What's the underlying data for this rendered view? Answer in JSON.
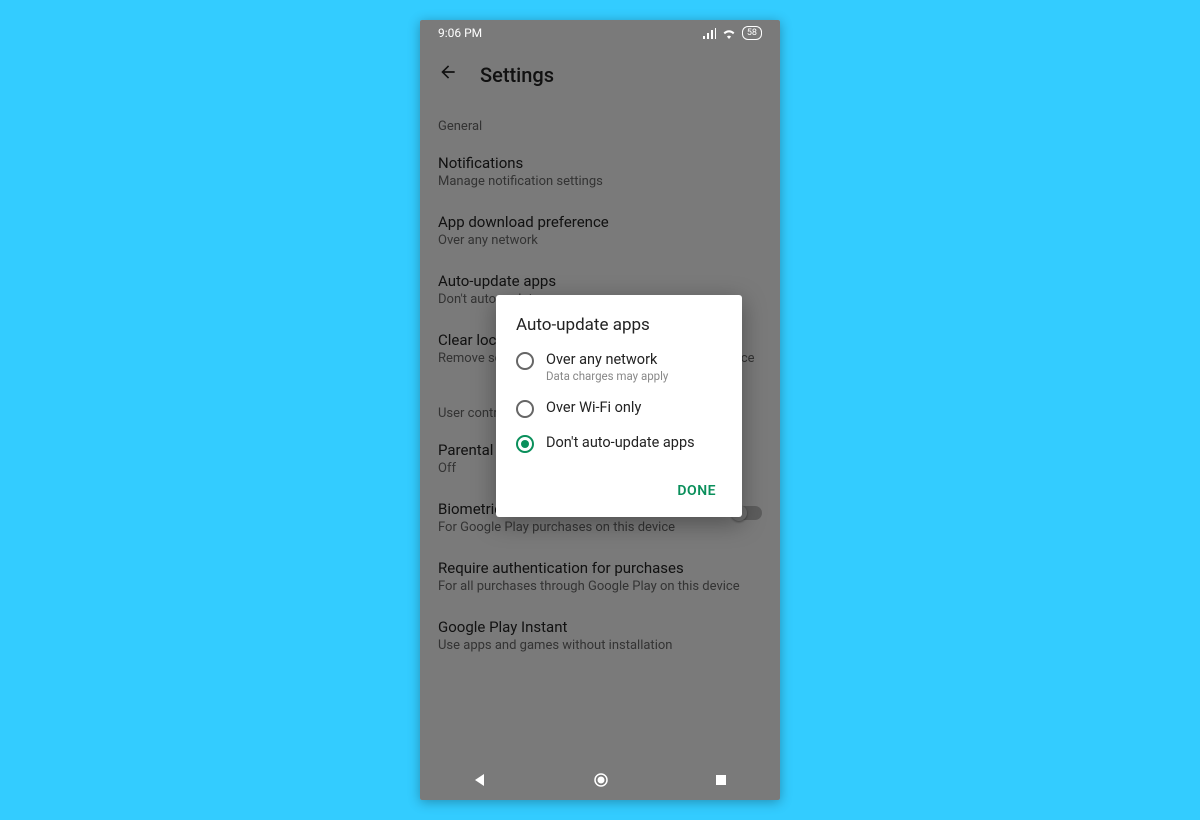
{
  "statusbar": {
    "time": "9:06 PM",
    "battery": "58"
  },
  "header": {
    "title": "Settings"
  },
  "sections": {
    "general_label": "General",
    "user_label": "User controls"
  },
  "rows": {
    "notifications": {
      "title": "Notifications",
      "sub": "Manage notification settings"
    },
    "download_pref": {
      "title": "App download preference",
      "sub": "Over any network"
    },
    "auto_update": {
      "title": "Auto-update apps",
      "sub": "Don't auto-update apps"
    },
    "clear": {
      "title": "Clear local search history",
      "sub": "Remove searches you have performed from this device"
    },
    "parental": {
      "title": "Parental controls",
      "sub": "Off"
    },
    "biometric": {
      "title": "Biometric authentication",
      "sub": "For Google Play purchases on this device"
    },
    "require_auth": {
      "title": "Require authentication for purchases",
      "sub": "For all purchases through Google Play on this device"
    },
    "instant": {
      "title": "Google Play Instant",
      "sub": "Use apps and games without installation"
    }
  },
  "dialog": {
    "title": "Auto-update apps",
    "options": [
      {
        "label": "Over any network",
        "sub": "Data charges may apply",
        "selected": false
      },
      {
        "label": "Over Wi-Fi only",
        "sub": "",
        "selected": false
      },
      {
        "label": "Don't auto-update apps",
        "sub": "",
        "selected": true
      }
    ],
    "done": "DONE"
  }
}
